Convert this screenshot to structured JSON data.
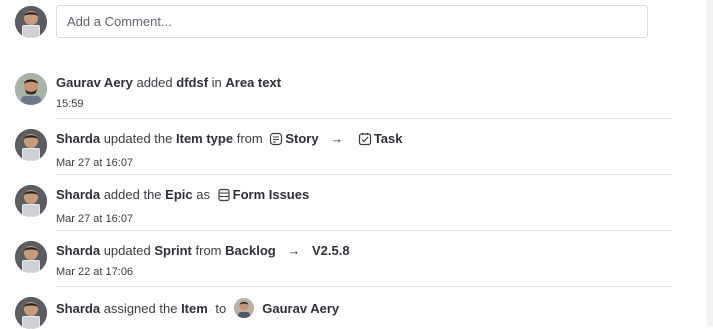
{
  "comment_input": {
    "placeholder": "Add a Comment..."
  },
  "activity": [
    {
      "user": "Gaurav Aery",
      "verb": "added",
      "value": "dfdsf",
      "prep": "in",
      "field": "Area text",
      "time": "15:59"
    },
    {
      "user": "Sharda",
      "verb": "updated the",
      "field": "Item type",
      "prep": "from",
      "from": "Story",
      "from_icon": "story-icon",
      "to": "Task",
      "to_icon": "task-icon",
      "time": "Mar 27 at 16:07"
    },
    {
      "user": "Sharda",
      "verb": "added the",
      "field": "Epic",
      "prep": "as",
      "value": "Form Issues",
      "value_icon": "epic-icon",
      "time": "Mar 27 at 16:07"
    },
    {
      "user": "Sharda",
      "verb": "updated",
      "field": "Sprint",
      "prep": "from",
      "from": "Backlog",
      "to": "V2.5.8",
      "time": "Mar 22 at 17:06"
    },
    {
      "user": "Sharda",
      "verb": "assigned the",
      "field": "Item",
      "prep": "to",
      "value": "Gaurav Aery",
      "value_icon": "user-avatar"
    }
  ],
  "arrow": "→",
  "colors": {
    "border": "#d9dce1",
    "separator": "#e7e9ec",
    "text": "#2d3036"
  }
}
